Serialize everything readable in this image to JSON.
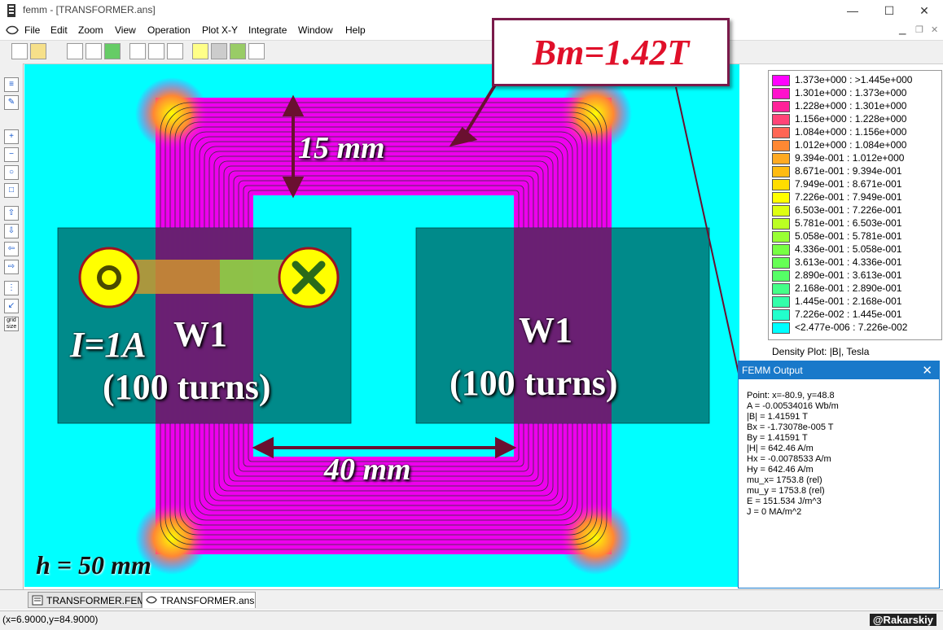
{
  "window": {
    "title": "femm - [TRANSFORMER.ans]",
    "minimize": "—",
    "maximize": "☐",
    "close": "✕"
  },
  "menu": [
    "File",
    "Edit",
    "Zoom",
    "View",
    "Operation",
    "Plot X-Y",
    "Integrate",
    "Window",
    "Help"
  ],
  "legend": {
    "rows": [
      {
        "label": "1.373e+000 : >1.445e+000",
        "color": "#ff00ff"
      },
      {
        "label": "1.301e+000 : 1.373e+000",
        "color": "#ff11cc"
      },
      {
        "label": "1.228e+000 : 1.301e+000",
        "color": "#ff2299"
      },
      {
        "label": "1.156e+000 : 1.228e+000",
        "color": "#ff4477"
      },
      {
        "label": "1.084e+000 : 1.156e+000",
        "color": "#ff6655"
      },
      {
        "label": "1.012e+000 : 1.084e+000",
        "color": "#ff8833"
      },
      {
        "label": "9.394e-001 : 1.012e+000",
        "color": "#ffaa22"
      },
      {
        "label": "8.671e-001 : 9.394e-001",
        "color": "#ffbb11"
      },
      {
        "label": "7.949e-001 : 8.671e-001",
        "color": "#ffdd00"
      },
      {
        "label": "7.226e-001 : 7.949e-001",
        "color": "#ffff00"
      },
      {
        "label": "6.503e-001 : 7.226e-001",
        "color": "#ddff11"
      },
      {
        "label": "5.781e-001 : 6.503e-001",
        "color": "#bbff22"
      },
      {
        "label": "5.058e-001 : 5.781e-001",
        "color": "#99ff33"
      },
      {
        "label": "4.336e-001 : 5.058e-001",
        "color": "#77ff44"
      },
      {
        "label": "3.613e-001 : 4.336e-001",
        "color": "#66ff55"
      },
      {
        "label": "2.890e-001 : 3.613e-001",
        "color": "#55ff66"
      },
      {
        "label": "2.168e-001 : 2.890e-001",
        "color": "#44ff88"
      },
      {
        "label": "1.445e-001 : 2.168e-001",
        "color": "#33ffaa"
      },
      {
        "label": "7.226e-002 : 1.445e-001",
        "color": "#22ffcc"
      },
      {
        "label": "<2.477e-006 : 7.226e-002",
        "color": "#00ffff"
      }
    ],
    "caption": "Density Plot: |B|, Tesla"
  },
  "output": {
    "title": "FEMM Output",
    "lines": [
      "Point: x=-80.9, y=48.8",
      "A   = -0.00534016 Wb/m",
      "|B| = 1.41591 T",
      "Bx  = -1.73078e-005 T",
      "By  = 1.41591 T",
      "|H| = 642.46 A/m",
      "Hx  = -0.0078533 A/m",
      "Hy  = 642.46 A/m",
      "mu_x= 1753.8 (rel)",
      "mu_y = 1753.8 (rel)",
      "E   = 151.534 J/m^3",
      "J   = 0 MA/m^2"
    ]
  },
  "annotations": {
    "bm": "Bm=1.42T",
    "limb_width": "15 mm",
    "window_width": "40 mm",
    "current": "I=1A",
    "w1_left": "W1",
    "w1_left_turns": "(100 turns)",
    "w1_right": "W1",
    "w1_right_turns": "(100 turns)",
    "height": "h = 50 mm"
  },
  "colors": {
    "air": "#00ffff",
    "core": "#ff00ff",
    "coil": "#008080",
    "arrow": "#7a1a4a",
    "bm_text": "#e0102a"
  },
  "tabs": [
    {
      "label": "TRANSFORMER.FEM",
      "active": false
    },
    {
      "label": "TRANSFORMER.ans",
      "active": true
    }
  ],
  "status": "(x=6.9000,y=84.9000)",
  "watermark": "@Rakarskiy"
}
